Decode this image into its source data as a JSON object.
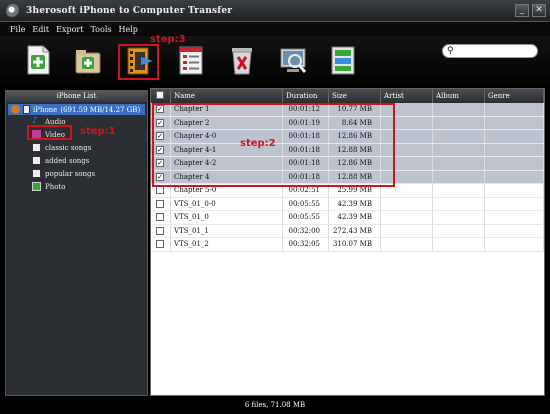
{
  "window": {
    "title": "3herosoft iPhone to Computer Transfer",
    "min_label": "_",
    "close_label": "✕"
  },
  "menu": [
    "File",
    "Edit",
    "Export",
    "Tools",
    "Help"
  ],
  "toolbar": {
    "buttons": [
      "add-file",
      "add-folder",
      "export-to-computer",
      "export-list",
      "delete",
      "search-device",
      "convert-settings"
    ]
  },
  "search": {
    "value": "",
    "placeholder": ""
  },
  "sidebar": {
    "header": "iPhone List",
    "device": "iPhone",
    "capacity": "(691.59 MB/14.27 GB)",
    "items": [
      {
        "label": "Audio"
      },
      {
        "label": "Video"
      },
      {
        "label": "classic songs"
      },
      {
        "label": "added songs"
      },
      {
        "label": "popular songs"
      },
      {
        "label": "Photo"
      }
    ]
  },
  "table": {
    "columns": [
      "",
      "Name",
      "Duration",
      "Size",
      "Artist",
      "Album",
      "Genre"
    ],
    "rows": [
      {
        "checked": true,
        "selected": true,
        "name": "Chapter 1",
        "duration": "00:01:12",
        "size": "10.77 MB",
        "artist": "",
        "album": "",
        "genre": ""
      },
      {
        "checked": true,
        "selected": true,
        "name": "Chapter 2",
        "duration": "00:01:19",
        "size": "8.64 MB",
        "artist": "",
        "album": "",
        "genre": ""
      },
      {
        "checked": true,
        "selected": true,
        "name": "Chapter 4-0",
        "duration": "00:01:18",
        "size": "12.86 MB",
        "artist": "",
        "album": "",
        "genre": ""
      },
      {
        "checked": true,
        "selected": true,
        "name": "Chapter 4-1",
        "duration": "00:01:18",
        "size": "12.88 MB",
        "artist": "",
        "album": "",
        "genre": ""
      },
      {
        "checked": true,
        "selected": true,
        "name": "Chapter 4-2",
        "duration": "00:01:18",
        "size": "12.86 MB",
        "artist": "",
        "album": "",
        "genre": ""
      },
      {
        "checked": true,
        "selected": true,
        "name": "Chapter 4",
        "duration": "00:01:18",
        "size": "12.88 MB",
        "artist": "",
        "album": "",
        "genre": ""
      },
      {
        "checked": false,
        "selected": false,
        "name": "Chapter 5-0",
        "duration": "00:02:51",
        "size": "25.99 MB",
        "artist": "",
        "album": "",
        "genre": ""
      },
      {
        "checked": false,
        "selected": false,
        "name": "VTS_01_0-0",
        "duration": "00:05:55",
        "size": "42.39 MB",
        "artist": "",
        "album": "",
        "genre": ""
      },
      {
        "checked": false,
        "selected": false,
        "name": "VTS_01_0",
        "duration": "00:05:55",
        "size": "42.39 MB",
        "artist": "",
        "album": "",
        "genre": ""
      },
      {
        "checked": false,
        "selected": false,
        "name": "VTS_01_1",
        "duration": "00:32:00",
        "size": "272.43 MB",
        "artist": "",
        "album": "",
        "genre": ""
      },
      {
        "checked": false,
        "selected": false,
        "name": "VTS_01_2",
        "duration": "00:32:05",
        "size": "310.07 MB",
        "artist": "",
        "album": "",
        "genre": ""
      }
    ]
  },
  "status": "6 files, 71.08 MB",
  "annotations": {
    "step1": "step:1",
    "step2": "step:2",
    "step3": "step:3",
    "color": "#d0141e"
  }
}
